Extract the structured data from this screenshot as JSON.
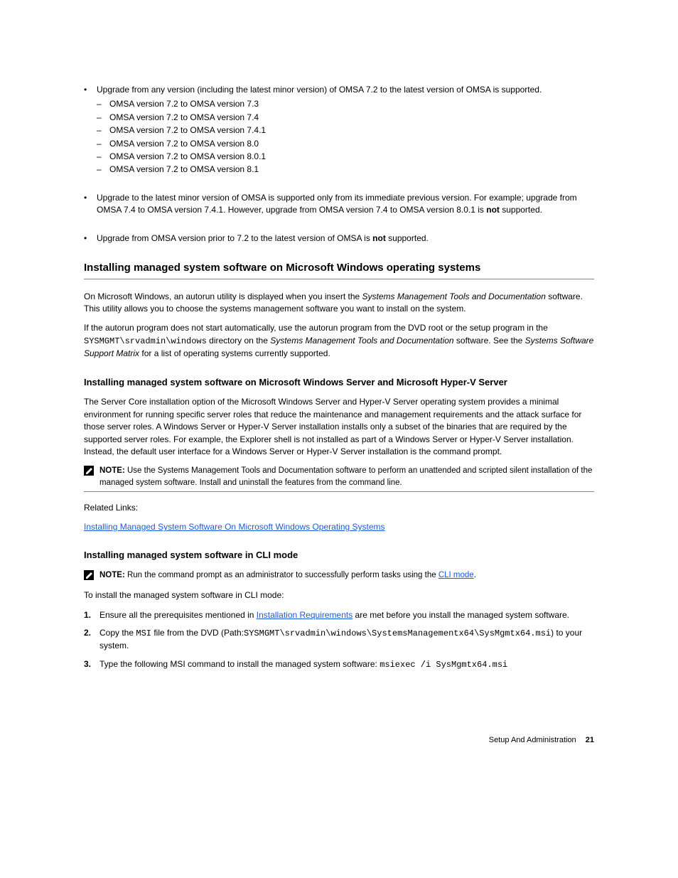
{
  "bullet1": {
    "lead": "Upgrade from any version (including the latest minor version) of OMSA 7.2 to the latest version of OMSA is supported.",
    "subs": [
      "OMSA version 7.2 to OMSA version 7.3",
      "OMSA version 7.2 to OMSA version 7.4",
      "OMSA version 7.2 to OMSA version 7.4.1",
      "OMSA version 7.2 to OMSA version 8.0",
      "OMSA version 7.2 to OMSA version 8.0.1",
      "OMSA version 7.2 to OMSA version 8.1"
    ]
  },
  "bullet2": {
    "lead_pre": "Upgrade to the latest minor version of OMSA is supported only from its immediate previous version. For example; upgrade from OMSA 7.4 to OMSA version 7.4.1. However, upgrade from OMSA version 7.4 to OMSA version 8.0.1 is ",
    "lead_bold": "not",
    "lead_post": " supported."
  },
  "bullet3": {
    "lead_pre": "Upgrade from OMSA version prior to 7.2 to the latest version of OMSA is ",
    "lead_bold": "not",
    "lead_post": " supported."
  },
  "section1_title": "Installing managed system software on Microsoft Windows operating systems",
  "section1_para_pre": "On Microsoft Windows, an autorun utility is displayed when you insert the ",
  "section1_para_em": "Systems Management Tools and Documentation",
  "section1_para_post": " software. This utility allows you to choose the systems management software you want to install on the system.",
  "section1_para2_pre": "If the autorun program does not start automatically, use the autorun program from the DVD root or the setup program in the ",
  "section1_para2_mono1": "SYSMGMT\\srvadmin\\windows",
  "section1_para2_mid": " directory on the ",
  "section1_para2_em": "Systems Management Tools and Documentation",
  "section1_para2_post": " software. See the ",
  "section1_para2_em2": "Systems Software Support Matrix",
  "section1_para2_tail": " for a list of operating systems currently supported.",
  "note1_label": "NOTE: ",
  "note1_text": "Use the Systems Management Tools and Documentation software to perform an unattended and scripted silent installation of the managed system software. Install and uninstall the features from the command line.",
  "section2_title": "Installing managed system software on Microsoft Windows Server and Microsoft Hyper-V Server",
  "section2_para_pre": "The Server Core installation option of the Microsoft Windows Server and Hyper-V Server operating system provides a minimal environment for running specific server roles that reduce the maintenance and management requirements and the attack surface for those server roles. A Windows Server or Hyper-V Server installation installs only a subset of the binaries that are required by the supported server roles. For example, the Explorer shell is not installed as part of a Windows Server or Hyper-V Server installation. Instead, the default user interface for a Windows Server or Hyper-V Server installation is the command prompt.",
  "link1_text": "Related Links:",
  "link1_item": "Installing Managed System Software On Microsoft Windows Operating Systems",
  "section3_title": "Installing managed system software in CLI mode",
  "note2_label": "NOTE: ",
  "note2_text_pre": "Run the command prompt as an administrator to successfully perform tasks using the ",
  "note2_link": "CLI mode",
  "note2_text_post": ".",
  "section3_lead": "To install the managed system software in CLI mode:",
  "steps": [
    {
      "num": "1.",
      "pre": "Ensure all the prerequisites mentioned in ",
      "link": "Installation Requirements",
      "post": " are met before you install the managed system software."
    },
    {
      "num": "2.",
      "pre": "Copy the ",
      "mono": "MSI",
      "mid": " file from the DVD (Path:",
      "mono2": "SYSMGMT\\srvadmin\\windows\\SystemsManagementx64\\SysMgmtx64.msi",
      "post": ") to your system."
    },
    {
      "num": "3.",
      "pre": "Type the following MSI command to install the managed system software: ",
      "mono": "msiexec /i SysMgmtx64.msi",
      "post": ""
    }
  ],
  "footer_text": "Setup And Administration",
  "footer_page": "21"
}
